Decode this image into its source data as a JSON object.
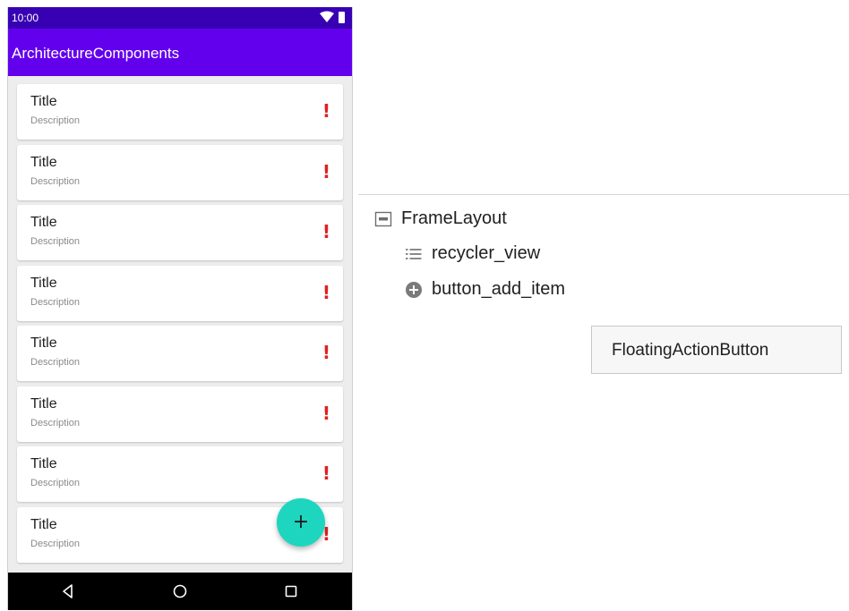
{
  "phone": {
    "status_bar": {
      "time": "10:00",
      "icons": [
        "wifi-icon",
        "battery-icon"
      ]
    },
    "app_bar": {
      "title": "ArchitectureComponents"
    },
    "notes": [
      {
        "title": "Title",
        "description": "Description",
        "priority": "!"
      },
      {
        "title": "Title",
        "description": "Description",
        "priority": "!"
      },
      {
        "title": "Title",
        "description": "Description",
        "priority": "!"
      },
      {
        "title": "Title",
        "description": "Description",
        "priority": "!"
      },
      {
        "title": "Title",
        "description": "Description",
        "priority": "!"
      },
      {
        "title": "Title",
        "description": "Description",
        "priority": "!"
      },
      {
        "title": "Title",
        "description": "Description",
        "priority": "!"
      },
      {
        "title": "Title",
        "description": "Description",
        "priority": "!"
      }
    ],
    "fab": {
      "symbol": "+",
      "icon": "add-icon"
    },
    "nav_bar": {
      "icons": [
        "back-icon",
        "home-icon",
        "recents-icon"
      ]
    }
  },
  "component_tree": {
    "root": {
      "label": "FrameLayout",
      "icon": "frame-layout-icon"
    },
    "children": [
      {
        "label": "recycler_view",
        "icon": "list-icon"
      },
      {
        "label": "button_add_item",
        "icon": "add-circle-icon"
      }
    ],
    "tooltip": "FloatingActionButton"
  },
  "colors": {
    "status_bar": "#3700b3",
    "app_bar": "#6200ee",
    "fab": "#1ed6bf",
    "priority": "#e02020",
    "nav_bar": "#000000"
  }
}
